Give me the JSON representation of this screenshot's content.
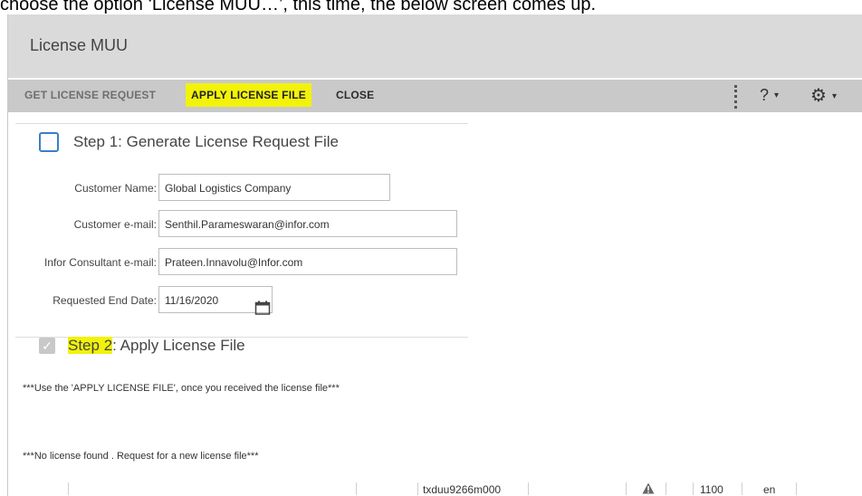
{
  "caption": "choose the option ‘License MUU…’, this time, the below screen comes up.",
  "window": {
    "title": "License MUU"
  },
  "toolbar": {
    "get_request": "GET LICENSE REQUEST",
    "apply": "APPLY LICENSE FILE",
    "close": "CLOSE",
    "help": "?",
    "caret": "▾",
    "gear": "⚙"
  },
  "step1": {
    "title": "Step 1: Generate License Request File",
    "fields": {
      "customer_name": {
        "label": "Customer Name:",
        "value": "Global Logistics Company"
      },
      "customer_email": {
        "label": "Customer e-mail:",
        "value": "Senthil.Parameswaran@infor.com"
      },
      "consultant_email": {
        "label": "Infor Consultant e-mail:",
        "value": "Prateen.Innavolu@Infor.com"
      },
      "end_date": {
        "label": "Requested End Date:",
        "value": "11/16/2020"
      }
    }
  },
  "step2": {
    "title_highlight": "Step 2",
    "title_rest": ": Apply License File",
    "check": "✓"
  },
  "notes": {
    "apply_note": "***Use the 'APPLY LICENSE FILE', once you received the license file***",
    "no_license": "***No license found . Request for a new license file***"
  },
  "statusbar": {
    "session": "txduu9266m000",
    "company": "1100",
    "language": "en"
  },
  "colors": {
    "highlight": "#f2f20a",
    "checkbox_border": "#3a7fc4",
    "titlebar": "#dadada",
    "toolbar": "#c9c9c9"
  },
  "icons": [
    "help-icon",
    "gear-icon",
    "calendar-icon",
    "warning-icon",
    "checkbox-icon"
  ]
}
